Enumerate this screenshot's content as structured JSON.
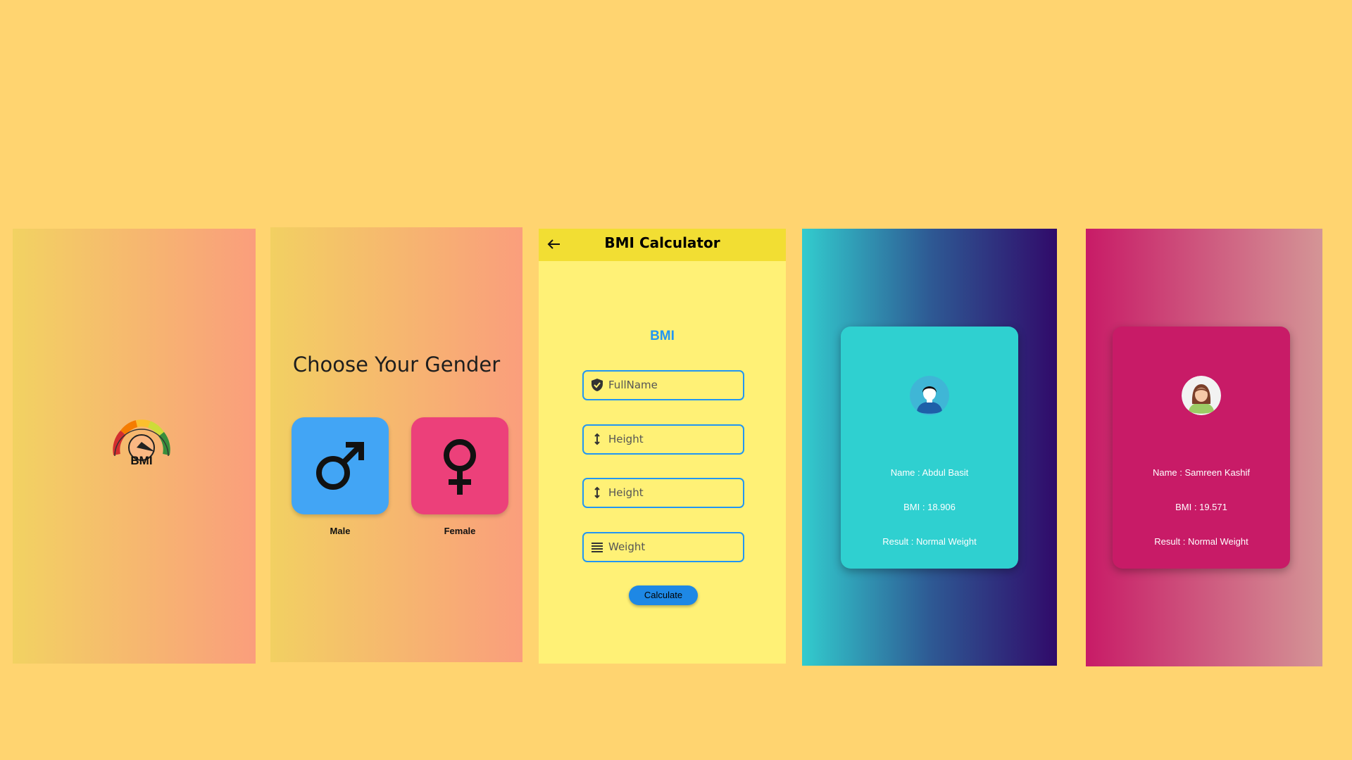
{
  "splash": {
    "logo_text": "BMI"
  },
  "gender": {
    "title": "Choose Your Gender",
    "male_label": "Male",
    "female_label": "Female"
  },
  "form": {
    "app_title": "BMI Calculator",
    "heading": "BMI",
    "fields": [
      {
        "placeholder": "FullName",
        "icon": "shield-check-icon"
      },
      {
        "placeholder": "Height",
        "icon": "height-arrow-icon"
      },
      {
        "placeholder": "Height",
        "icon": "height-arrow-icon"
      },
      {
        "placeholder": "Weight",
        "icon": "weight-lines-icon"
      }
    ],
    "calculate_label": "Calculate"
  },
  "result_male": {
    "name": "Name : Abdul Basit",
    "bmi": "BMI : 18.906",
    "result": "Result : Normal Weight"
  },
  "result_female": {
    "name": "Name : Samreen Kashif",
    "bmi": "BMI : 19.571",
    "result": "Result : Normal Weight"
  },
  "colors": {
    "background": "#FFD470",
    "male": "#42A5F5",
    "female": "#EC407A",
    "appbar": "#F2DE33",
    "form_bg": "#FFF176",
    "accent_blue": "#2196F3",
    "teal_card": "#2FD0D0",
    "magenta_card": "#C81B67"
  }
}
